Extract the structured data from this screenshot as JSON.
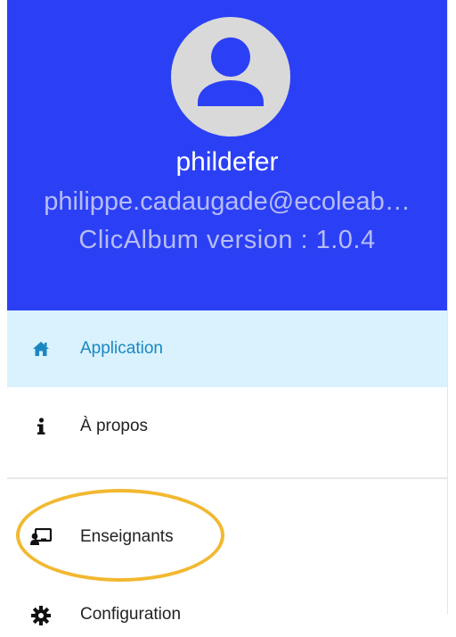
{
  "header": {
    "username": "phildefer",
    "email": "philippe.cadaugade@ecoleab…",
    "version": "ClicAlbum version : 1.0.4",
    "background_color": "#2b40f5",
    "avatar_icon": "account-circle-icon"
  },
  "menu": {
    "items": [
      {
        "label": "Application",
        "icon": "home-icon",
        "selected": true
      },
      {
        "label": "À propos",
        "icon": "info-icon",
        "selected": false
      },
      {
        "label": "Enseignants",
        "icon": "teacher-icon",
        "selected": false
      },
      {
        "label": "Configuration",
        "icon": "gear-icon",
        "selected": false
      }
    ],
    "selected_bg_color": "#d9f2fe",
    "selected_text_color": "#1a87c2"
  },
  "annotation": {
    "color": "#f2b830",
    "highlights": "Enseignants"
  }
}
